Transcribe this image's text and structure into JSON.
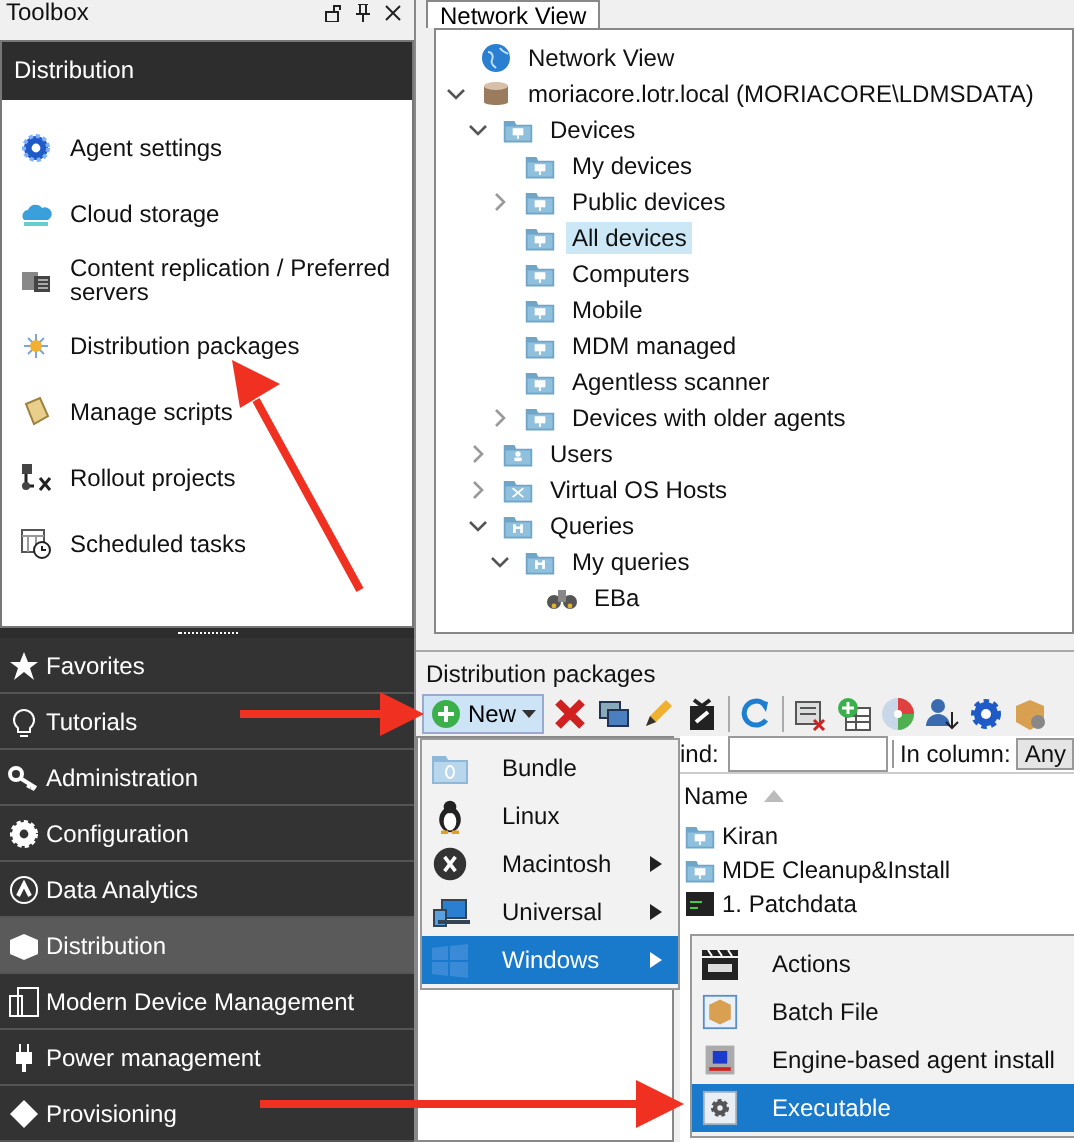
{
  "toolbox": {
    "title": "Toolbox",
    "header": "Distribution",
    "items": [
      {
        "label": "Agent settings"
      },
      {
        "label": "Cloud storage"
      },
      {
        "label": "Content replication / Preferred servers"
      },
      {
        "label": "Distribution packages"
      },
      {
        "label": "Manage scripts"
      },
      {
        "label": "Rollout projects"
      },
      {
        "label": "Scheduled tasks"
      }
    ]
  },
  "nav": [
    {
      "label": "Favorites",
      "selected": false
    },
    {
      "label": "Tutorials",
      "selected": false
    },
    {
      "label": "Administration",
      "selected": false
    },
    {
      "label": "Configuration",
      "selected": false
    },
    {
      "label": "Data Analytics",
      "selected": false
    },
    {
      "label": "Distribution",
      "selected": true
    },
    {
      "label": "Modern Device Management",
      "selected": false
    },
    {
      "label": "Power management",
      "selected": false
    },
    {
      "label": "Provisioning",
      "selected": false
    }
  ],
  "network_view": {
    "tab": "Network View",
    "tree": [
      {
        "label": "Network View",
        "kind": "globe",
        "selected": false
      },
      {
        "label": "moriacore.lotr.local (MORIACORE\\LDMSDATA)",
        "kind": "database",
        "expanded": true,
        "selected": false,
        "children": [
          {
            "label": "Devices",
            "kind": "folder",
            "expanded": true,
            "selected": false,
            "children": [
              {
                "label": "My devices",
                "kind": "folder",
                "selected": false
              },
              {
                "label": "Public devices",
                "kind": "folder",
                "expanded": false,
                "selected": false
              },
              {
                "label": "All devices",
                "kind": "folder",
                "selected": true
              },
              {
                "label": "Computers",
                "kind": "folder",
                "selected": false
              },
              {
                "label": "Mobile",
                "kind": "folder",
                "selected": false
              },
              {
                "label": "MDM managed",
                "kind": "folder",
                "selected": false
              },
              {
                "label": "Agentless scanner",
                "kind": "folder",
                "selected": false
              },
              {
                "label": "Devices with older agents",
                "kind": "folder",
                "expanded": false,
                "selected": false
              }
            ]
          },
          {
            "label": "Users",
            "kind": "userfolder",
            "expanded": false,
            "selected": false
          },
          {
            "label": "Virtual OS Hosts",
            "kind": "hostfolder",
            "expanded": false,
            "selected": false
          },
          {
            "label": "Queries",
            "kind": "queryfolder",
            "expanded": true,
            "selected": false,
            "children": [
              {
                "label": "My queries",
                "kind": "queryfolder",
                "expanded": true,
                "selected": false,
                "children": [
                  {
                    "label": "EBa",
                    "kind": "query",
                    "selected": false
                  }
                ]
              }
            ]
          }
        ]
      }
    ]
  },
  "packages": {
    "title": "Distribution packages",
    "new_button": "New",
    "find_label": "ind:",
    "column_label": "In column:",
    "column_value": "Any",
    "name_header": "Name",
    "rows": [
      {
        "label": "Kiran",
        "kind": "folder"
      },
      {
        "label": "MDE Cleanup&Install",
        "kind": "folder"
      },
      {
        "label": "1. Patchdata",
        "kind": "script"
      }
    ]
  },
  "new_menu": [
    {
      "label": "Bundle",
      "submenu": false,
      "selected": false
    },
    {
      "label": "Linux",
      "submenu": false,
      "selected": false
    },
    {
      "label": "Macintosh",
      "submenu": true,
      "selected": false
    },
    {
      "label": "Universal",
      "submenu": true,
      "selected": false
    },
    {
      "label": "Windows",
      "submenu": true,
      "selected": true
    }
  ],
  "windows_submenu": [
    {
      "label": "Actions",
      "selected": false
    },
    {
      "label": "Batch File",
      "selected": false
    },
    {
      "label": "Engine-based agent install",
      "selected": false
    },
    {
      "label": "Executable",
      "selected": true
    }
  ]
}
